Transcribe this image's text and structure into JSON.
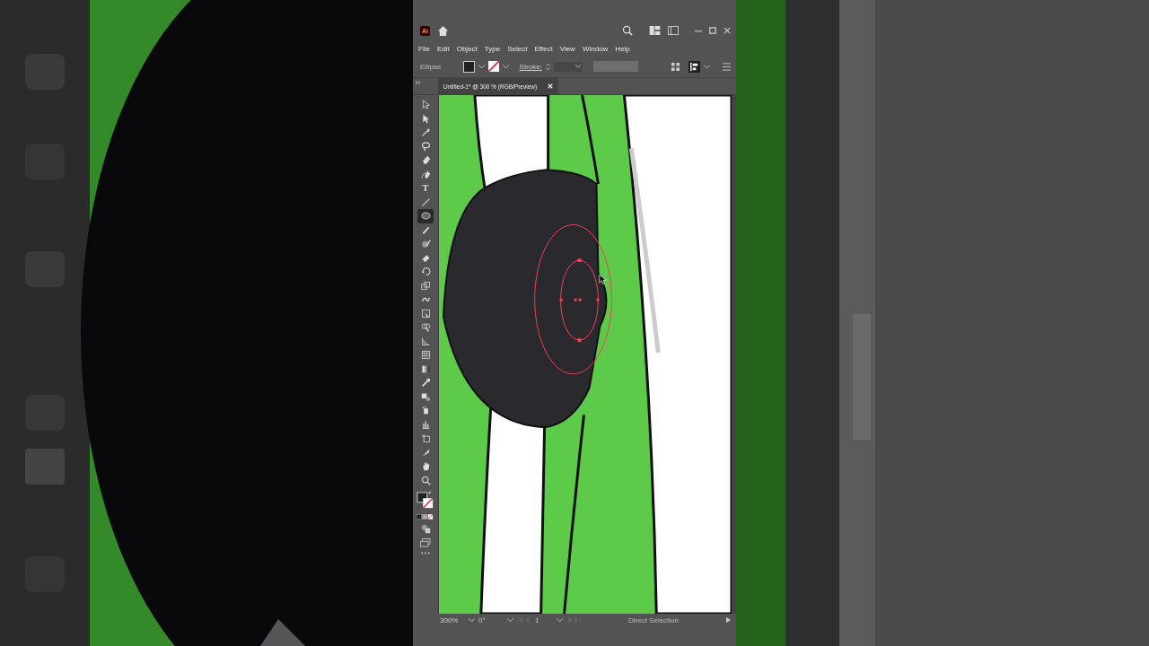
{
  "app": {
    "badge": "Ai"
  },
  "menu": [
    "File",
    "Edit",
    "Object",
    "Type",
    "Select",
    "Effect",
    "View",
    "Window",
    "Help"
  ],
  "control_bar": {
    "selection": "Ellipse",
    "stroke_label": "Stroke:"
  },
  "document_tab": {
    "title": "Untitled-1* @ 300 % (RGB/Preview)"
  },
  "tools": [
    {
      "kind": "select",
      "selected": false
    },
    {
      "kind": "direct",
      "selected": false
    },
    {
      "kind": "wand",
      "selected": false
    },
    {
      "kind": "lasso",
      "selected": false
    },
    {
      "kind": "pen",
      "selected": false
    },
    {
      "kind": "curvature",
      "selected": false
    },
    {
      "kind": "type",
      "glyph": "T",
      "selected": false
    },
    {
      "kind": "line",
      "selected": false
    },
    {
      "kind": "ellipse",
      "selected": true
    },
    {
      "kind": "brush",
      "selected": false
    },
    {
      "kind": "shaper",
      "selected": false
    },
    {
      "kind": "eraser",
      "selected": false
    },
    {
      "kind": "rotate",
      "selected": false
    },
    {
      "kind": "scale",
      "selected": false
    },
    {
      "kind": "warp",
      "selected": false
    },
    {
      "kind": "transform",
      "selected": false
    },
    {
      "kind": "builder",
      "selected": false
    },
    {
      "kind": "perspective",
      "selected": false
    },
    {
      "kind": "mesh",
      "selected": false
    },
    {
      "kind": "gradient",
      "selected": false
    },
    {
      "kind": "eyedropper",
      "selected": false
    },
    {
      "kind": "blend",
      "selected": false
    },
    {
      "kind": "symbol",
      "selected": false
    },
    {
      "kind": "graph",
      "selected": false
    },
    {
      "kind": "artboard",
      "selected": false
    },
    {
      "kind": "slice",
      "selected": false
    },
    {
      "kind": "hand",
      "selected": false
    },
    {
      "kind": "zoom",
      "selected": false
    }
  ],
  "status_bar": {
    "zoom": "300%",
    "rotation": "0°",
    "artboard": "1",
    "tool": "Direct Selection"
  }
}
